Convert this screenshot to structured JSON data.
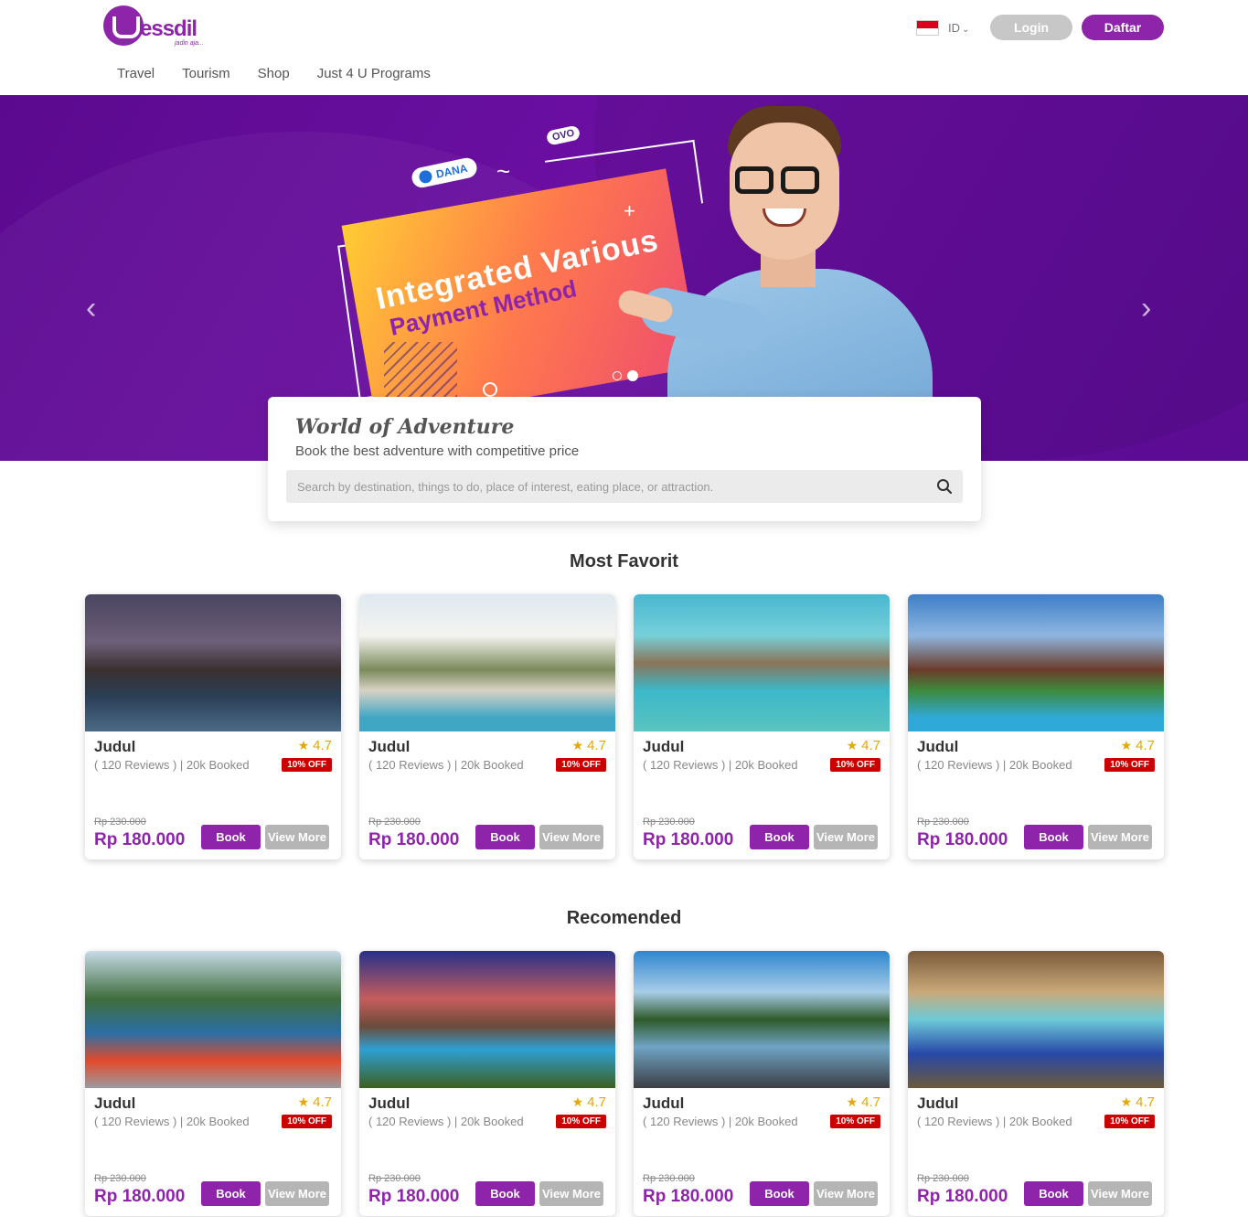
{
  "header": {
    "logo_text": "essdil",
    "logo_tagline": "jadin aja...",
    "nav": [
      "Travel",
      "Tourism",
      "Shop",
      "Just 4 U Programs"
    ],
    "lang": "ID",
    "login_label": "Login",
    "daftar_label": "Daftar"
  },
  "hero": {
    "badge_dana": "DANA",
    "badge_ovo": "OVO",
    "line1": "Integrated Various",
    "line2": "Payment Method",
    "arrow_left": "‹",
    "arrow_right": "›"
  },
  "search": {
    "title": "World of Adventure",
    "subtitle": "Book the best adventure with competitive price",
    "placeholder": "Search by destination, things to do, place of interest, eating place, or attraction."
  },
  "sections": {
    "favorit_title": "Most Favorit",
    "recomended_title": "Recomended"
  },
  "card": {
    "title": "Judul",
    "rating": "4.7",
    "meta": "( 120 Reviews ) | 20k Booked",
    "off": "10% OFF",
    "old_price": "Rp 230.000",
    "price": "Rp 180.000",
    "book_label": "Book",
    "more_label": "View More"
  },
  "colors": {
    "brand": "#8e24aa",
    "login_bg": "#c7c7c7",
    "off_badge": "#cc0000",
    "rating": "#e6a800"
  }
}
